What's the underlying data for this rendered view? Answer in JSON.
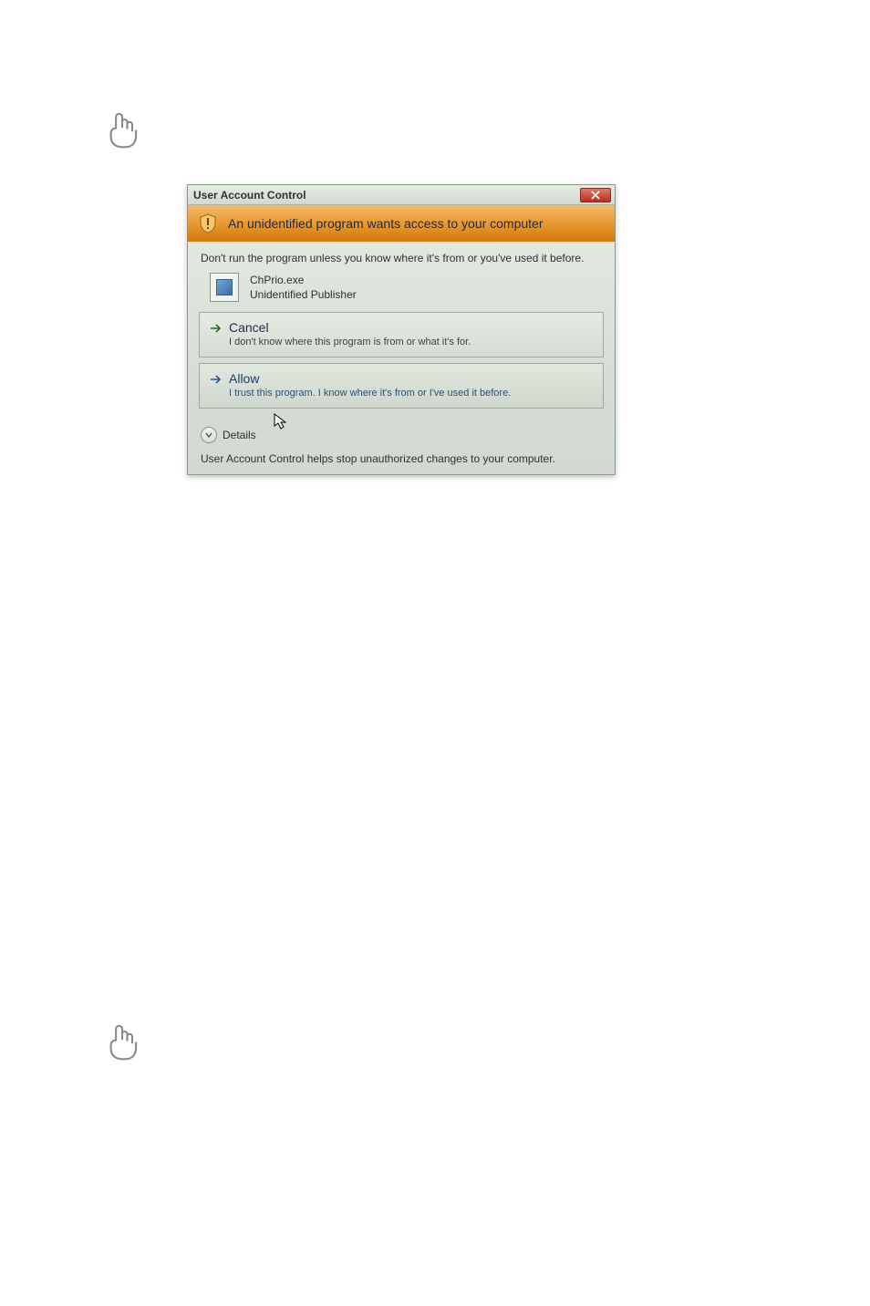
{
  "titlebar": {
    "text": "User Account Control"
  },
  "banner": {
    "text": "An unidentified program wants access to your computer"
  },
  "intro": "Don't run the program unless you know where it's from or you've used it before.",
  "program": {
    "name": "ChPrio.exe",
    "publisher": "Unidentified Publisher"
  },
  "commands": {
    "cancel": {
      "title": "Cancel",
      "desc": "I don't know where this program is from or what it's for."
    },
    "allow": {
      "title": "Allow",
      "desc": "I trust this program. I know where it's from or I've used it before."
    }
  },
  "details": {
    "label": "Details"
  },
  "footer": "User Account Control helps stop unauthorized changes to your computer."
}
